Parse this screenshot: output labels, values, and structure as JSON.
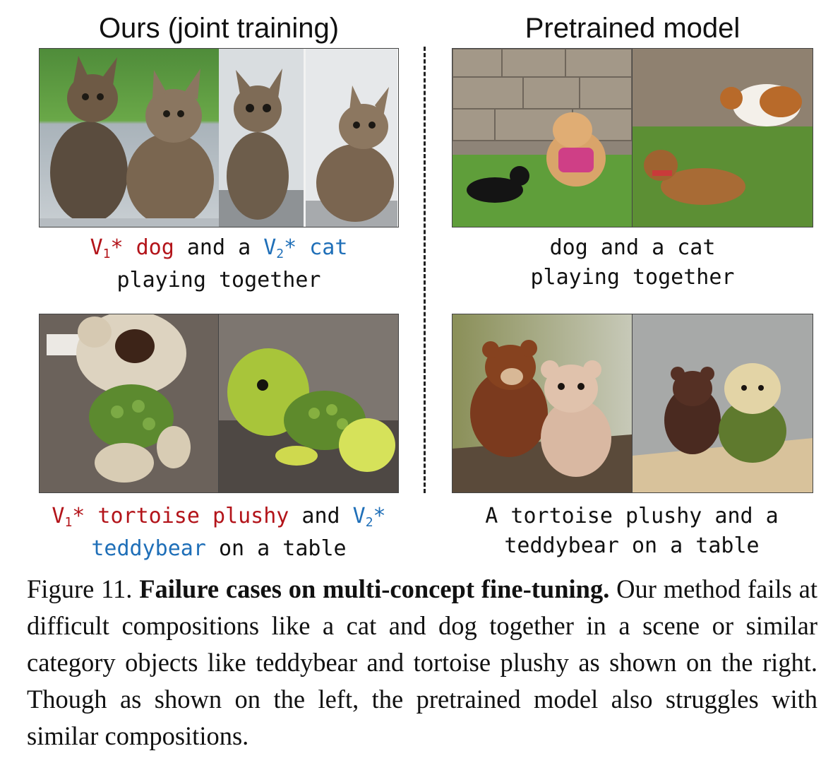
{
  "columns": {
    "left_title": "Ours (joint training)",
    "right_title": "Pretrained model"
  },
  "captions": {
    "row1_left": {
      "v1": "V",
      "v1_sub": "1",
      "v1_star": "*",
      "concept1": " dog",
      "mid": " and a ",
      "v2": "V",
      "v2_sub": "2",
      "v2_star": "*",
      "concept2": " cat",
      "line2": "playing together"
    },
    "row1_right": {
      "line1": "dog and a cat",
      "line2": "playing together"
    },
    "row2_left": {
      "v1": "V",
      "v1_sub": "1",
      "v1_star": "*",
      "concept1": " tortoise plushy",
      "mid": " and ",
      "v2": "V",
      "v2_sub": "2",
      "v2_star": "*",
      "concept2": "teddybear",
      "tail": " on a table"
    },
    "row2_right": {
      "line1": "A tortoise plushy and a",
      "line2": "teddybear on a table"
    }
  },
  "figure_caption": {
    "label": "Figure 11. ",
    "bold": "Failure cases on multi-concept fine-tuning.",
    "body": " Our method fails at difficult compositions like a cat and dog together in a scene or similar category objects like teddybear and tortoise plushy as shown on the right. Though as shown on the left, the pretrained model also struggles with similar compositions."
  },
  "colors": {
    "concept_v1": "#b3141a",
    "concept_v2": "#1f6fb8"
  }
}
